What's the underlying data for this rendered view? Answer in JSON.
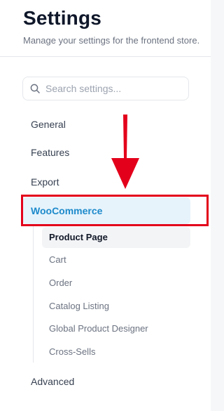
{
  "header": {
    "title": "Settings",
    "subtitle": "Manage your settings for the frontend store."
  },
  "search": {
    "placeholder": "Search settings...",
    "icon": "search-icon"
  },
  "nav": {
    "general": "General",
    "features": "Features",
    "export": "Export",
    "woocommerce": "WooCommerce",
    "advanced": "Advanced"
  },
  "woocommerce_sub": [
    "Product Page",
    "Cart",
    "Order",
    "Catalog Listing",
    "Global Product Designer",
    "Cross-Sells"
  ],
  "colors": {
    "accent": "#1d8acb",
    "highlight_bg": "#e6f3fb",
    "annotation_red": "#e3001b"
  },
  "annotation": {
    "arrow_icon": "arrow-down-icon"
  }
}
